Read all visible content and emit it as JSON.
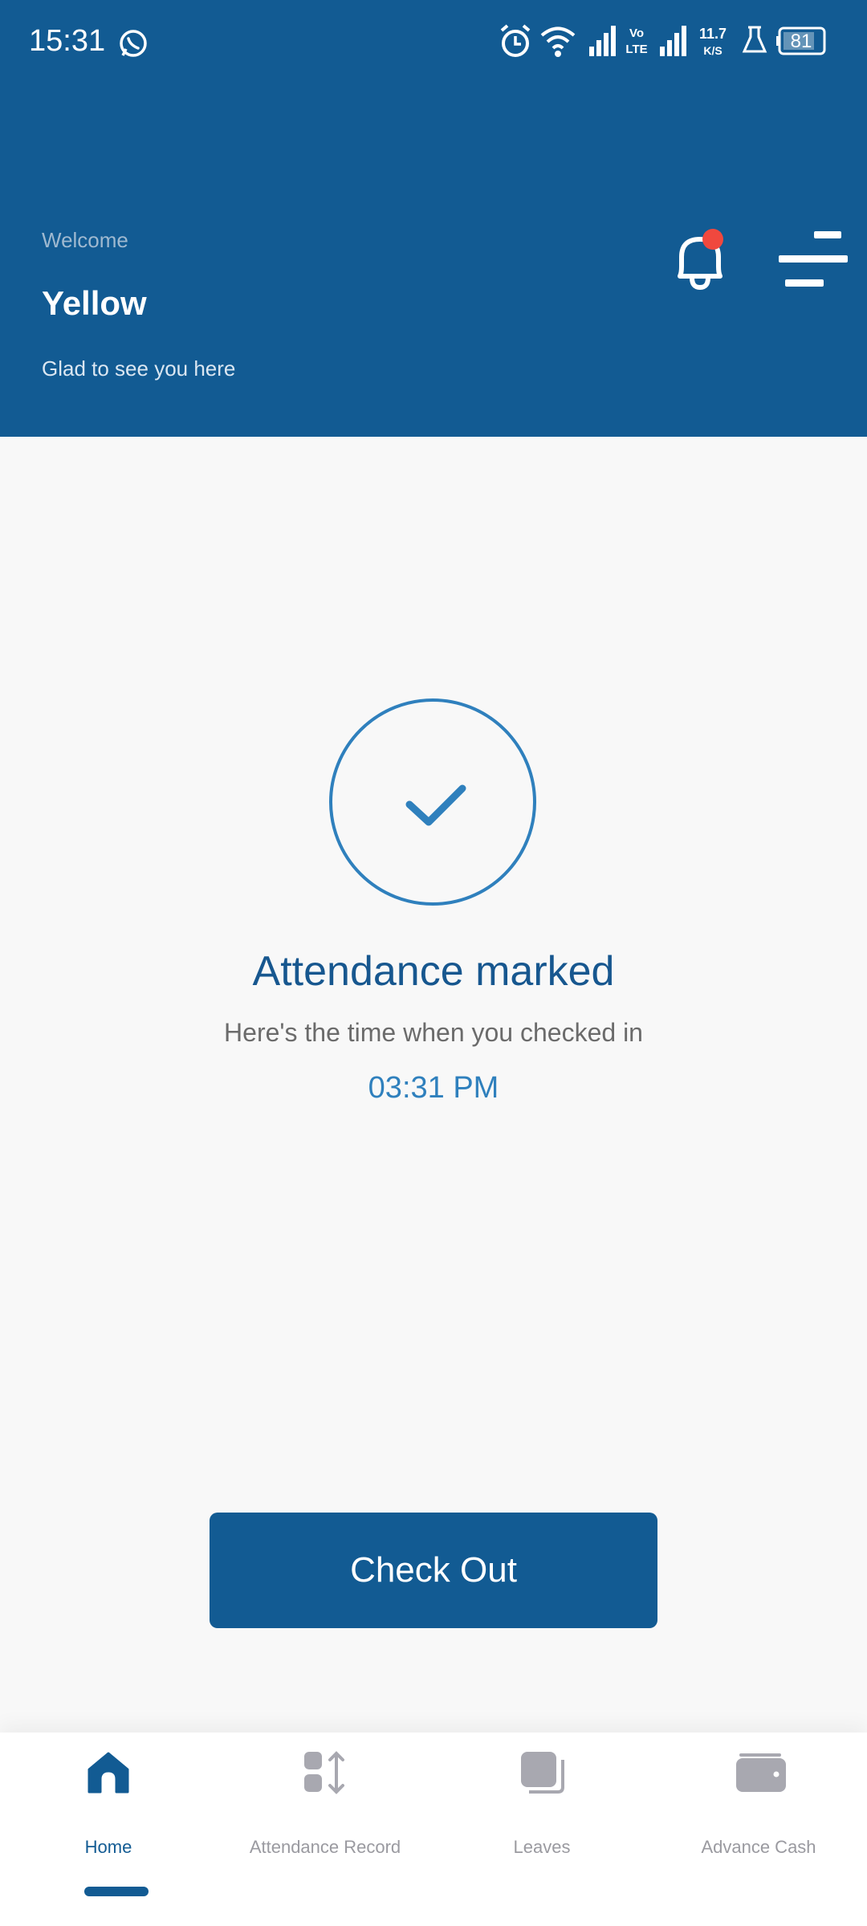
{
  "status_bar": {
    "time": "15:31",
    "battery": "81",
    "network_speed": "11.7\nK/S"
  },
  "header": {
    "welcome_label": "Welcome",
    "user_name": "Yellow",
    "greeting": "Glad to see you here"
  },
  "attendance": {
    "title": "Attendance marked",
    "subtitle": "Here's the time when you checked in",
    "checkin_time": "03:31 PM"
  },
  "checkout_button": {
    "label": "Check Out"
  },
  "bottom_nav": {
    "items": [
      {
        "label": "Home",
        "icon": "home-icon",
        "active": true
      },
      {
        "label": "Attendance Record",
        "icon": "attendance-record-icon",
        "active": false
      },
      {
        "label": "Leaves",
        "icon": "leaves-icon",
        "active": false
      },
      {
        "label": "Advance Cash",
        "icon": "wallet-icon",
        "active": false
      }
    ]
  },
  "colors": {
    "primary": "#125b93",
    "accent": "#2f80bd",
    "notification_dot": "#f0483e",
    "background": "#f8f8f8"
  }
}
